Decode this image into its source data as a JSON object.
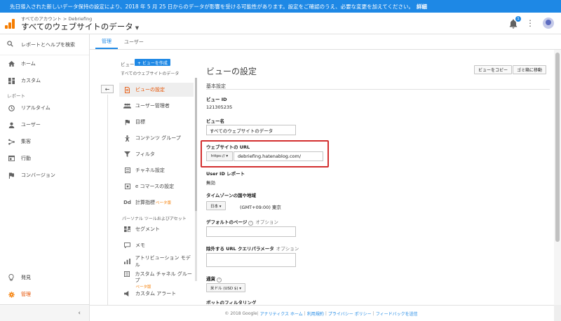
{
  "banner": {
    "message": "先日導入された新しいデータ保持の設定により、2018 年 5 月 25 日からのデータが影響を受ける可能性があります。設定をご確認のうえ、必要な変更を加えてください。",
    "link": "詳細"
  },
  "header": {
    "breadcrumb": "すべてのアカウント > Debriefing",
    "title": "すべてのウェブサイトのデータ",
    "notification_count": "1"
  },
  "leftnav": {
    "search": "レポートとヘルプを検索",
    "home": "ホーム",
    "custom": "カスタム",
    "reports_section": "レポート",
    "realtime": "リアルタイム",
    "audience": "ユーザー",
    "acquisition": "集客",
    "behavior": "行動",
    "conversions": "コンバージョン",
    "discover": "発見",
    "admin": "管理",
    "collapse": "‹"
  },
  "tabs": [
    {
      "label": "管理"
    },
    {
      "label": "ユーザー"
    }
  ],
  "view_column": {
    "label": "ビュー",
    "create_button": "+ ビューを作成",
    "view_name": "すべてのウェブサイトのデータ",
    "back": "←",
    "items": [
      {
        "label": "ビューの設定",
        "icon": "doc-icon"
      },
      {
        "label": "ユーザー管理者",
        "icon": "users-icon"
      },
      {
        "label": "目標",
        "icon": "flag-icon"
      },
      {
        "label": "コンテンツ グループ",
        "icon": "figure-icon"
      },
      {
        "label": "フィルタ",
        "icon": "filter-icon"
      },
      {
        "label": "チャネル設定",
        "icon": "channel-icon"
      },
      {
        "label": "e コマースの設定",
        "icon": "cart-icon"
      },
      {
        "label": "計算指標",
        "beta": "ベータ版",
        "icon": "dd-icon"
      }
    ],
    "personal_section": "パーソナル ツールおよびアセット",
    "personal_items": [
      {
        "label": "セグメント",
        "icon": "segment-icon"
      },
      {
        "label": "メモ",
        "icon": "note-icon"
      },
      {
        "label": "アトリビューション モデル",
        "icon": "attribution-icon"
      },
      {
        "label": "カスタム チャネル グループ",
        "beta": "ベータ版",
        "icon": "channel-group-icon"
      },
      {
        "label": "カスタム アラート",
        "icon": "alert-icon"
      }
    ]
  },
  "settings": {
    "title": "ビューの設定",
    "copy_button": "ビューをコピー",
    "trash_button": "ゴミ箱に移動",
    "basic_section": "基本設定",
    "view_id_label": "ビュー ID",
    "view_id": "121305235",
    "view_name_label": "ビュー名",
    "view_name_value": "すべてのウェブサイトのデータ",
    "website_url_label": "ウェブサイトの URL",
    "protocol": "https:// ▾",
    "website_url": "debriefing.hatenablog.com/",
    "userid_label": "User ID レポート",
    "userid_value": "無効",
    "timezone_label": "タイムゾーンの国や地域",
    "timezone_country": "日本 ▾",
    "timezone_value": "(GMT+09:00) 東京",
    "default_page_label": "デフォルトのページ",
    "default_page_optional": "オプション",
    "exclude_params_label": "除外する URL クエリパラメータ",
    "exclude_params_optional": "オプション",
    "currency_label": "通貨",
    "currency_value": "米ドル (USD $) ▾",
    "bot_filtering_label": "ボットのフィルタリング"
  },
  "footer": {
    "copyright": "© 2018 Google",
    "link_home": "アナリティクス ホーム",
    "link_terms": "利用規約",
    "link_privacy": "プライバシー ポリシー",
    "link_feedback": "フィードバックを送信"
  }
}
